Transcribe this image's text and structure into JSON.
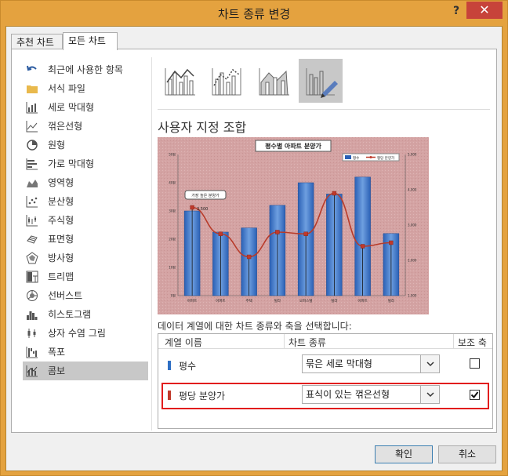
{
  "window": {
    "title": "차트 종류 변경",
    "help": "?",
    "close": "✕"
  },
  "tabs": [
    {
      "label": "추천 차트"
    },
    {
      "label": "모든 차트"
    }
  ],
  "nav": {
    "items": [
      {
        "label": "최근에 사용한 항목",
        "icon": "undo-icon"
      },
      {
        "label": "서식 파일",
        "icon": "folder-icon"
      },
      {
        "label": "세로 막대형",
        "icon": "column-chart-icon"
      },
      {
        "label": "꺾은선형",
        "icon": "line-chart-icon"
      },
      {
        "label": "원형",
        "icon": "pie-chart-icon"
      },
      {
        "label": "가로 막대형",
        "icon": "bar-chart-icon"
      },
      {
        "label": "영역형",
        "icon": "area-chart-icon"
      },
      {
        "label": "분산형",
        "icon": "scatter-chart-icon"
      },
      {
        "label": "주식형",
        "icon": "stock-chart-icon"
      },
      {
        "label": "표면형",
        "icon": "surface-chart-icon"
      },
      {
        "label": "방사형",
        "icon": "radar-chart-icon"
      },
      {
        "label": "트리맵",
        "icon": "treemap-chart-icon"
      },
      {
        "label": "선버스트",
        "icon": "sunburst-chart-icon"
      },
      {
        "label": "히스토그램",
        "icon": "histogram-chart-icon"
      },
      {
        "label": "상자 수염 그림",
        "icon": "box-whisker-chart-icon"
      },
      {
        "label": "폭포",
        "icon": "waterfall-chart-icon"
      },
      {
        "label": "콤보",
        "icon": "combo-chart-icon",
        "selected": true
      }
    ]
  },
  "subtypes": [
    {
      "icon": "clustered-column-line-icon"
    },
    {
      "icon": "clustered-column-line-secondary-icon"
    },
    {
      "icon": "stacked-area-clustered-column-icon"
    },
    {
      "icon": "custom-combination-icon",
      "selected": true
    }
  ],
  "section_title": "사용자 지정 조합",
  "preview": {
    "title": "평수별 아파트 분양가",
    "legend": [
      "평수",
      "평당 분양가"
    ],
    "categories": [
      "아파트",
      "아파트",
      "주택",
      "빌라",
      "오피스텔",
      "빌라",
      "아파트",
      "빌라"
    ],
    "columns": [
      30,
      22.5,
      24,
      32,
      40,
      36,
      42,
      22
    ],
    "line": [
      3500,
      2750,
      2100,
      2800,
      2750,
      3900,
      2400,
      2500
    ],
    "left_ticks": [
      "0평",
      "10평",
      "20평",
      "30평",
      "40평",
      "50평"
    ],
    "right_ticks": [
      "1,000",
      "2,000",
      "3,000",
      "4,000",
      "5,000"
    ],
    "callout": "가장 높은 분양가",
    "callout_value": "3,500"
  },
  "instruction": "데이터 계열에 대한 차트 종류와 축을 선택합니다:",
  "table": {
    "headers": {
      "name": "계열 이름",
      "type": "차트 종류",
      "axis": "보조 축"
    },
    "rows": [
      {
        "name": "평수",
        "type": "묶은 세로 막대형",
        "secondary": false,
        "color": "#2e6fc4"
      },
      {
        "name": "평당 분양가",
        "type": "표식이 있는 꺾은선형",
        "secondary": true,
        "color": "#c0392b"
      }
    ]
  },
  "buttons": {
    "ok": "확인",
    "cancel": "취소"
  },
  "colors": {
    "accent": "#e4a23f",
    "close": "#c7433a",
    "highlight": "#e21d1d",
    "preview_bg": "#d6a6a6"
  }
}
